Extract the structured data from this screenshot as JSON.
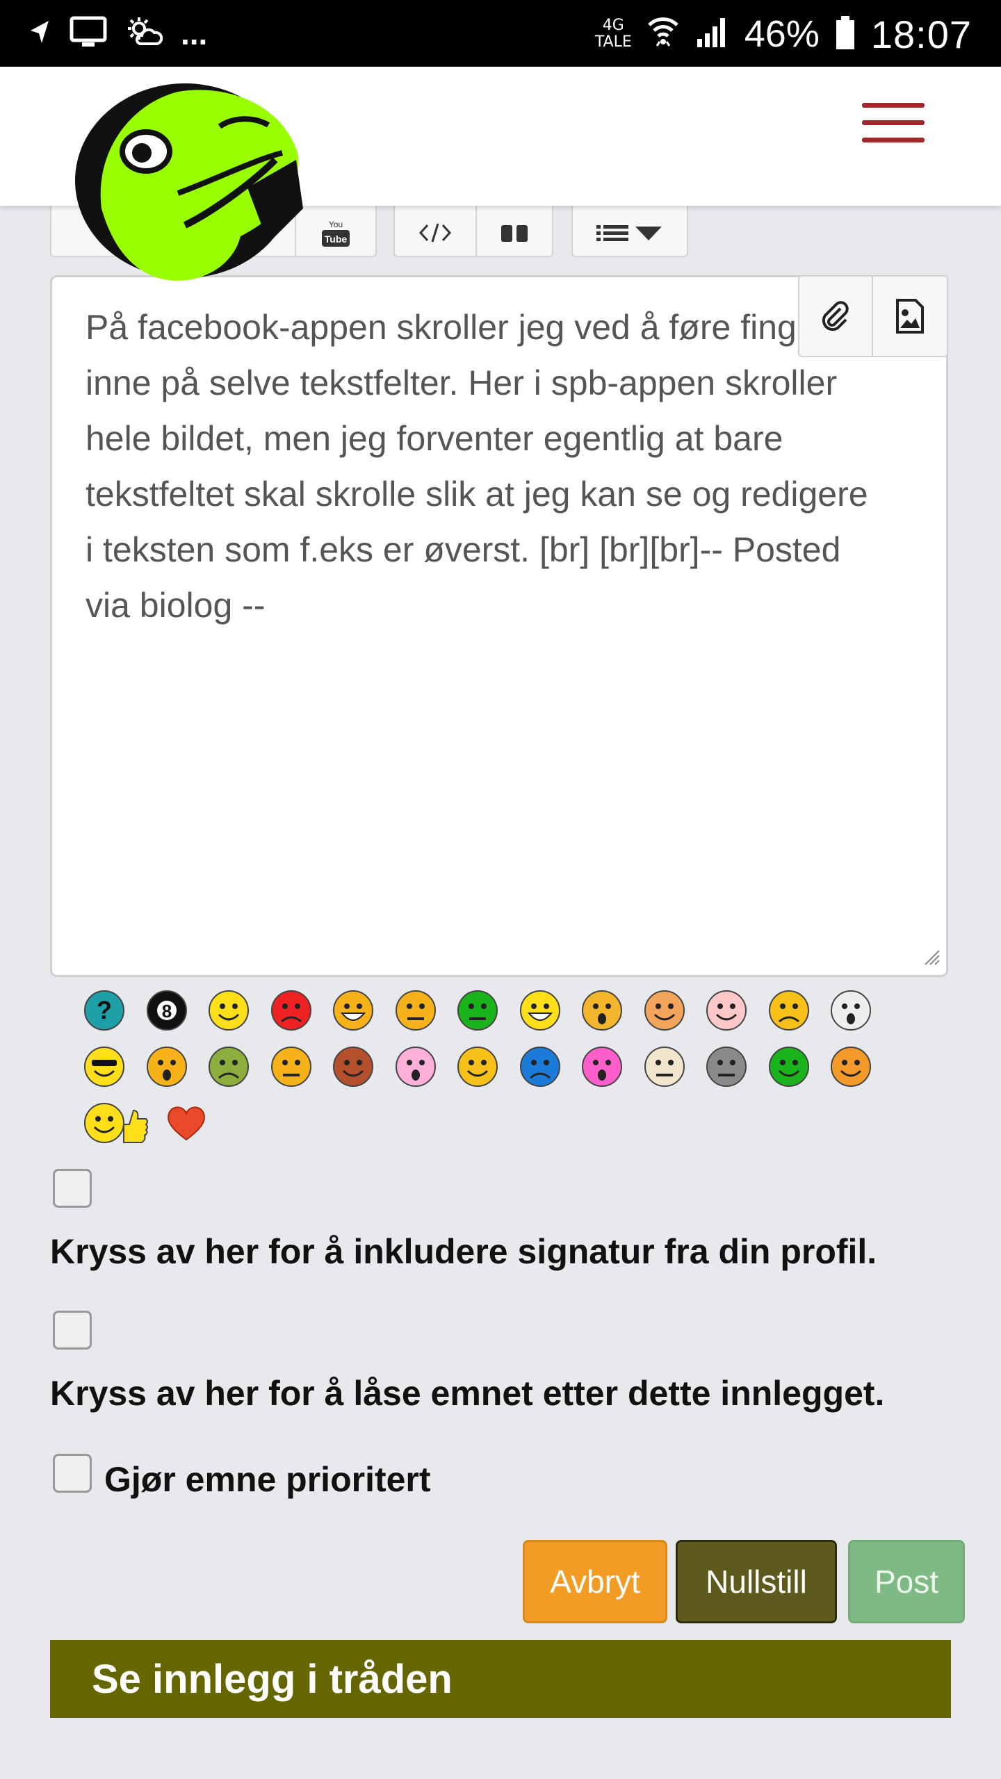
{
  "status_bar": {
    "net_top": "4G",
    "net_bottom": "TALE",
    "battery": "46%",
    "time": "18:07",
    "dots": "...",
    "icons": [
      "navigation-icon",
      "cast-icon",
      "weather-icon",
      "wifi-icon",
      "signal-icon",
      "battery-icon"
    ]
  },
  "header": {
    "logo_icon": "frog-logo",
    "menu_icon": "hamburger-menu-icon",
    "brand_color": "#a3282b"
  },
  "toolbar": {
    "buttons": [
      "youtube-icon",
      "code-icon",
      "quote-icon",
      "list-dropdown-icon"
    ],
    "youtube_label_top": "You",
    "youtube_label_bottom": "Tube"
  },
  "editor": {
    "text": "På facebook-appen skroller jeg ved å føre fingeren inne på selve tekstfelter. Her i spb-appen skroller hele bildet, men jeg forventer egentlig at bare tekstfeltet skal skrolle slik at jeg kan se og redigere i teksten som f.eks er øverst. [br] [br][br]-- Posted via biolog --",
    "attach_icon": "paperclip-icon",
    "image_icon": "image-icon"
  },
  "smileys": [
    "question-smiley",
    "8ball-smiley",
    "smile",
    "angry",
    "laugh",
    "annoyed",
    "green-smile",
    "grin",
    "eek",
    "wink-face",
    "blush",
    "sad",
    "clown",
    "cool",
    "surprised-o",
    "sick",
    "confused",
    "devil",
    "kiss",
    "wink",
    "cry",
    "shocked",
    "rolleyes",
    "gray-face",
    "tongue",
    "happy-orange",
    "thumbs-up",
    "heart"
  ],
  "options": {
    "signature_label": "Kryss av her for å inkludere signatur fra din profil.",
    "lock_label": "Kryss av her for å låse emnet etter dette innlegget.",
    "priority_label": "Gjør emne prioritert"
  },
  "buttons": {
    "cancel": "Avbryt",
    "reset": "Nullstill",
    "post": "Post"
  },
  "thread_link": "Se innlegg i tråden"
}
